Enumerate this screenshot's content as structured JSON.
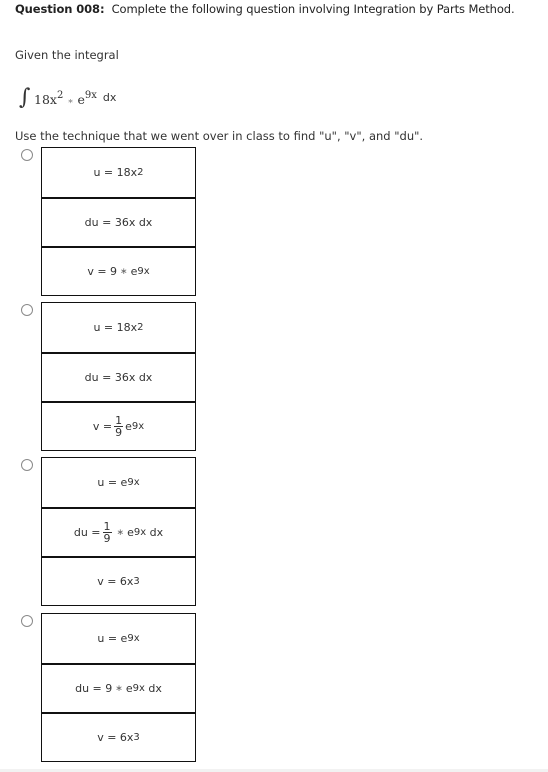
{
  "question": {
    "label": "Question 008:",
    "text": "Complete the following question involving Integration by Parts Method."
  },
  "given_label": "Given the integral",
  "integral": {
    "sign": "∫",
    "coef": "18x",
    "coef_exp": "2",
    "star": "∗",
    "base": "e",
    "base_exp": "9x",
    "dx": "dx"
  },
  "instruction": "Use the technique that we went over in class to find \"u\", \"v\", and \"du\".",
  "options": [
    {
      "u": {
        "lhs": "u = 18x",
        "exp": "2"
      },
      "du": {
        "text": "du = 36x dx"
      },
      "v": {
        "lhs": "v = 9",
        "star": "∗",
        "base": "e",
        "exp": "9x"
      }
    },
    {
      "u": {
        "lhs": "u = 18x",
        "exp": "2"
      },
      "du": {
        "text": "du = 36x dx"
      },
      "v": {
        "lhs": "v =",
        "num": "1",
        "den": "9",
        "base": "e",
        "exp": "9x"
      }
    },
    {
      "u": {
        "lhs": "u = e",
        "exp": "9x"
      },
      "du": {
        "lhs": "du =",
        "num": "1",
        "den": "9",
        "star": "∗",
        "base": "e",
        "exp": "9x",
        "tail": "dx"
      },
      "v": {
        "lhs": "v = 6x",
        "exp": "3"
      }
    },
    {
      "u": {
        "lhs": "u = e",
        "exp": "9x"
      },
      "du": {
        "lhs": "du = 9",
        "star": "∗",
        "base": "e",
        "exp": "9x",
        "tail": "dx"
      },
      "v": {
        "lhs": "v = 6x",
        "exp": "3"
      }
    }
  ]
}
